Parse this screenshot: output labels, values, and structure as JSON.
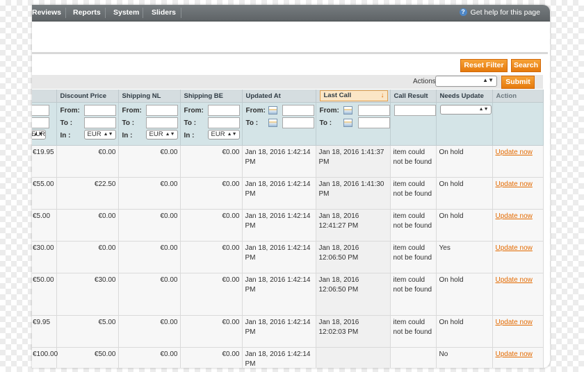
{
  "nav": {
    "items": [
      "Reviews",
      "Reports",
      "System",
      "Sliders"
    ],
    "help": "Get help for this page"
  },
  "buttons": {
    "reset_filter": "Reset Filter",
    "search": "Search",
    "submit": "Submit"
  },
  "actions": {
    "label": "Actions",
    "selected": ""
  },
  "columns": {
    "discount_price": "Discount Price",
    "shipping_nl": "Shipping NL",
    "shipping_be": "Shipping BE",
    "updated_at": "Updated At",
    "last_call": "Last Call",
    "call_result": "Call Result",
    "needs_update": "Needs Update",
    "action": "Action"
  },
  "filter": {
    "from": "From:",
    "to": "To :",
    "in": "In :",
    "currency": "EUR"
  },
  "rows": [
    {
      "c0": "€19.95",
      "discount": "€0.00",
      "nl": "€0.00",
      "be": "€0.00",
      "updated": "Jan 18, 2016 1:42:14 PM",
      "last_call": "Jan 18, 2016 1:41:37 PM",
      "result": "item could not be found",
      "needs": "On hold",
      "action": "Update now"
    },
    {
      "c0": "€55.00",
      "discount": "€22.50",
      "nl": "€0.00",
      "be": "€0.00",
      "updated": "Jan 18, 2016 1:42:14 PM",
      "last_call": "Jan 18, 2016 1:41:30 PM",
      "result": "item could not be found",
      "needs": "On hold",
      "action": "Update now"
    },
    {
      "c0": "€5.00",
      "discount": "€0.00",
      "nl": "€0.00",
      "be": "€0.00",
      "updated": "Jan 18, 2016 1:42:14 PM",
      "last_call": "Jan 18, 2016 12:41:27 PM",
      "result": "item could not be found",
      "needs": "On hold",
      "action": "Update now"
    },
    {
      "c0": "€30.00",
      "discount": "€0.00",
      "nl": "€0.00",
      "be": "€0.00",
      "updated": "Jan 18, 2016 1:42:14 PM",
      "last_call": "Jan 18, 2016 12:06:50 PM",
      "result": "item could not be found",
      "needs": "Yes",
      "action": "Update now"
    },
    {
      "c0": "€50.00",
      "discount": "€30.00",
      "nl": "€0.00",
      "be": "€0.00",
      "updated": "Jan 18, 2016 1:42:14 PM",
      "last_call": "Jan 18, 2016 12:06:50 PM",
      "result": "item could not be found",
      "needs": "On hold",
      "action": "Update now"
    },
    {
      "c0": "€9.95",
      "discount": "€5.00",
      "nl": "€0.00",
      "be": "€0.00",
      "updated": "Jan 18, 2016 1:42:14 PM",
      "last_call": "Jan 18, 2016 12:02:03 PM",
      "result": "item could not be found",
      "needs": "On hold",
      "action": "Update now"
    },
    {
      "c0": "€100.00",
      "discount": "€50.00",
      "nl": "€0.00",
      "be": "€0.00",
      "updated": "Jan 18, 2016 1:42:14 PM",
      "last_call": "",
      "result": "",
      "needs": "No",
      "action": "Update now"
    }
  ]
}
